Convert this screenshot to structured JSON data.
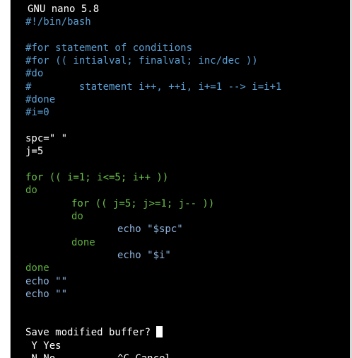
{
  "app_title": "GNU nano 5.8",
  "lines": [
    "#!/bin/bash",
    "#for statement of conditions",
    "#for (( intialval; finalval; inc/dec ))",
    "#do",
    "#        statement i++, ++i, i+=1 --> i=i+1",
    "#done",
    "#i=0",
    "spc=\" \"",
    "j=5",
    "for (( i=1; i<=5; i++ ))",
    "do",
    "for (( j=5; j>=1; j-- ))",
    "do",
    "echo \"$spc\"",
    "done",
    "echo \"$i\"",
    "done",
    "echo \"\"",
    "echo \"\""
  ],
  "prompt": {
    "question": "Save modified buffer?",
    "yes_option": " Y Yes",
    "no_option": " N No",
    "cancel_option": "^C Cancel"
  },
  "colors": {
    "background": "#000000",
    "comment": "#5a9fd4",
    "keyword": "#6cc24a",
    "string": "#d6d84a",
    "echo": "#8fb4dd",
    "text": "#ffffff"
  }
}
